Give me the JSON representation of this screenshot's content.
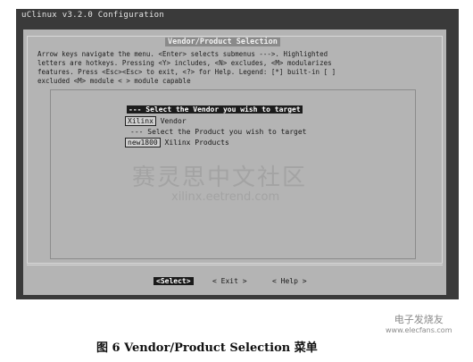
{
  "window": {
    "title": "uClinux v3.2.0 Configuration"
  },
  "dialog": {
    "title": "Vendor/Product Selection",
    "help_lines": [
      "Arrow keys navigate the menu.  <Enter> selects submenus --->.  Highlighted",
      "letters are hotkeys.  Pressing <Y> includes, <N> excludes, <M> modularizes",
      "features.  Press <Esc><Esc> to exit, <?> for Help.  Legend: [*] built-in  [ ]",
      "excluded  <M> module  < > module capable"
    ],
    "items": [
      {
        "type": "separator",
        "text": "--- Select the Vendor you wish to target"
      },
      {
        "type": "choice",
        "value": "Xilinx",
        "label": "Vendor"
      },
      {
        "type": "separator",
        "text": "--- Select the Product you wish to target"
      },
      {
        "type": "choice",
        "value": "new1800",
        "label": "Xilinx Products"
      }
    ]
  },
  "buttons": {
    "select": "<Select>",
    "exit": "< Exit >",
    "help": "< Help >"
  },
  "watermark": {
    "chinese": "赛灵思中文社区",
    "url": "xilinx.eetrend.com"
  },
  "caption": "图 6   Vendor/Product Selection 菜单",
  "logo": {
    "name": "电子发烧友",
    "site": "www.elecfans.com"
  }
}
